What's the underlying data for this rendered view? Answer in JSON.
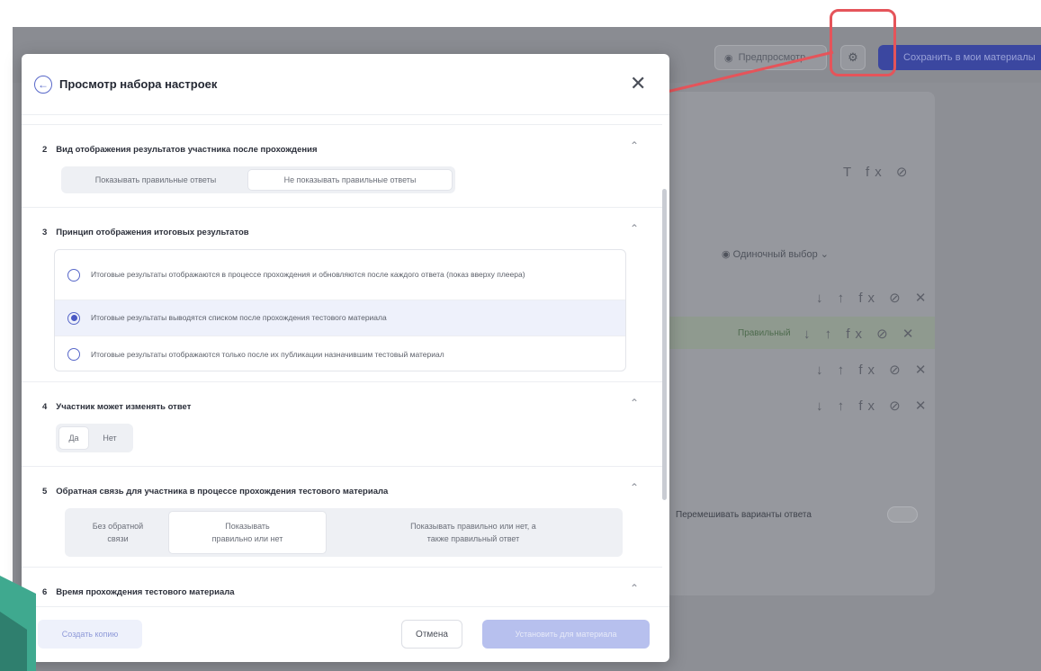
{
  "background_app": {
    "preview_button": "Предпросмотр",
    "save_button": "Сохранить в мои материалы",
    "single_choice": "Одиночный выбор",
    "correct_label": "Правильный",
    "shuffle_label": "Перемешивать варианты ответа"
  },
  "modal": {
    "title": "Просмотр набора настроек",
    "sections": [
      {
        "number": "2",
        "title": "Вид отображения результатов участника после прохождения",
        "options": [
          "Показывать правильные ответы",
          "Не показывать правильные ответы"
        ],
        "selected": "Не показывать правильные ответы"
      },
      {
        "number": "3",
        "title": "Принцип отображения итоговых результатов",
        "options": [
          "Итоговые результаты отображаются в процессе прохождения и обновляются после каждого ответа (показ вверху плеера)",
          "Итоговые результаты выводятся списком после прохождения тестового материала",
          "Итоговые результаты отображаются только после их публикации назначившим тестовый материал"
        ],
        "selected": "Итоговые результаты выводятся списком после прохождения тестового материала"
      },
      {
        "number": "4",
        "title": "Участник может изменять ответ",
        "options": [
          "Да",
          "Нет"
        ],
        "selected": "Да"
      },
      {
        "number": "5",
        "title": "Обратная связь для участника в процессе прохождения тестового материала",
        "options": [
          "Без обратной связи",
          "Показывать правильно или нет",
          "Показывать правильно или нет, а также правильный ответ"
        ],
        "selected": "Показывать правильно или нет"
      },
      {
        "number": "6",
        "title": "Время прохождения тестового материала"
      }
    ],
    "footer": {
      "copy_button": "Создать копию",
      "cancel_button": "Отмена",
      "apply_button": "Установить для материала"
    }
  },
  "colors": {
    "accent": "#4a59c4",
    "highlight": "#e5545a"
  }
}
